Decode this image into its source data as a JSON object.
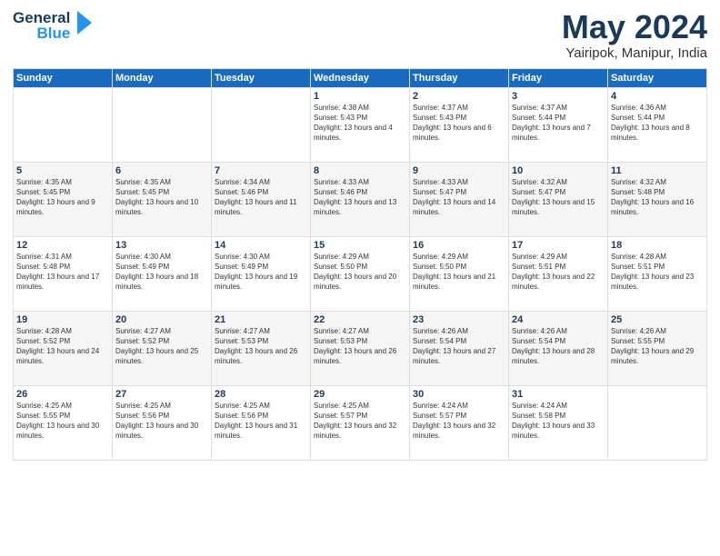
{
  "header": {
    "logo_line1": "General",
    "logo_line2": "Blue",
    "month": "May 2024",
    "location": "Yairipok, Manipur, India"
  },
  "days_of_week": [
    "Sunday",
    "Monday",
    "Tuesday",
    "Wednesday",
    "Thursday",
    "Friday",
    "Saturday"
  ],
  "weeks": [
    [
      {
        "day": "",
        "sunrise": "",
        "sunset": "",
        "daylight": ""
      },
      {
        "day": "",
        "sunrise": "",
        "sunset": "",
        "daylight": ""
      },
      {
        "day": "",
        "sunrise": "",
        "sunset": "",
        "daylight": ""
      },
      {
        "day": "1",
        "sunrise": "Sunrise: 4:38 AM",
        "sunset": "Sunset: 5:43 PM",
        "daylight": "Daylight: 13 hours and 4 minutes."
      },
      {
        "day": "2",
        "sunrise": "Sunrise: 4:37 AM",
        "sunset": "Sunset: 5:43 PM",
        "daylight": "Daylight: 13 hours and 6 minutes."
      },
      {
        "day": "3",
        "sunrise": "Sunrise: 4:37 AM",
        "sunset": "Sunset: 5:44 PM",
        "daylight": "Daylight: 13 hours and 7 minutes."
      },
      {
        "day": "4",
        "sunrise": "Sunrise: 4:36 AM",
        "sunset": "Sunset: 5:44 PM",
        "daylight": "Daylight: 13 hours and 8 minutes."
      }
    ],
    [
      {
        "day": "5",
        "sunrise": "Sunrise: 4:35 AM",
        "sunset": "Sunset: 5:45 PM",
        "daylight": "Daylight: 13 hours and 9 minutes."
      },
      {
        "day": "6",
        "sunrise": "Sunrise: 4:35 AM",
        "sunset": "Sunset: 5:45 PM",
        "daylight": "Daylight: 13 hours and 10 minutes."
      },
      {
        "day": "7",
        "sunrise": "Sunrise: 4:34 AM",
        "sunset": "Sunset: 5:46 PM",
        "daylight": "Daylight: 13 hours and 11 minutes."
      },
      {
        "day": "8",
        "sunrise": "Sunrise: 4:33 AM",
        "sunset": "Sunset: 5:46 PM",
        "daylight": "Daylight: 13 hours and 13 minutes."
      },
      {
        "day": "9",
        "sunrise": "Sunrise: 4:33 AM",
        "sunset": "Sunset: 5:47 PM",
        "daylight": "Daylight: 13 hours and 14 minutes."
      },
      {
        "day": "10",
        "sunrise": "Sunrise: 4:32 AM",
        "sunset": "Sunset: 5:47 PM",
        "daylight": "Daylight: 13 hours and 15 minutes."
      },
      {
        "day": "11",
        "sunrise": "Sunrise: 4:32 AM",
        "sunset": "Sunset: 5:48 PM",
        "daylight": "Daylight: 13 hours and 16 minutes."
      }
    ],
    [
      {
        "day": "12",
        "sunrise": "Sunrise: 4:31 AM",
        "sunset": "Sunset: 5:48 PM",
        "daylight": "Daylight: 13 hours and 17 minutes."
      },
      {
        "day": "13",
        "sunrise": "Sunrise: 4:30 AM",
        "sunset": "Sunset: 5:49 PM",
        "daylight": "Daylight: 13 hours and 18 minutes."
      },
      {
        "day": "14",
        "sunrise": "Sunrise: 4:30 AM",
        "sunset": "Sunset: 5:49 PM",
        "daylight": "Daylight: 13 hours and 19 minutes."
      },
      {
        "day": "15",
        "sunrise": "Sunrise: 4:29 AM",
        "sunset": "Sunset: 5:50 PM",
        "daylight": "Daylight: 13 hours and 20 minutes."
      },
      {
        "day": "16",
        "sunrise": "Sunrise: 4:29 AM",
        "sunset": "Sunset: 5:50 PM",
        "daylight": "Daylight: 13 hours and 21 minutes."
      },
      {
        "day": "17",
        "sunrise": "Sunrise: 4:29 AM",
        "sunset": "Sunset: 5:51 PM",
        "daylight": "Daylight: 13 hours and 22 minutes."
      },
      {
        "day": "18",
        "sunrise": "Sunrise: 4:28 AM",
        "sunset": "Sunset: 5:51 PM",
        "daylight": "Daylight: 13 hours and 23 minutes."
      }
    ],
    [
      {
        "day": "19",
        "sunrise": "Sunrise: 4:28 AM",
        "sunset": "Sunset: 5:52 PM",
        "daylight": "Daylight: 13 hours and 24 minutes."
      },
      {
        "day": "20",
        "sunrise": "Sunrise: 4:27 AM",
        "sunset": "Sunset: 5:52 PM",
        "daylight": "Daylight: 13 hours and 25 minutes."
      },
      {
        "day": "21",
        "sunrise": "Sunrise: 4:27 AM",
        "sunset": "Sunset: 5:53 PM",
        "daylight": "Daylight: 13 hours and 26 minutes."
      },
      {
        "day": "22",
        "sunrise": "Sunrise: 4:27 AM",
        "sunset": "Sunset: 5:53 PM",
        "daylight": "Daylight: 13 hours and 26 minutes."
      },
      {
        "day": "23",
        "sunrise": "Sunrise: 4:26 AM",
        "sunset": "Sunset: 5:54 PM",
        "daylight": "Daylight: 13 hours and 27 minutes."
      },
      {
        "day": "24",
        "sunrise": "Sunrise: 4:26 AM",
        "sunset": "Sunset: 5:54 PM",
        "daylight": "Daylight: 13 hours and 28 minutes."
      },
      {
        "day": "25",
        "sunrise": "Sunrise: 4:26 AM",
        "sunset": "Sunset: 5:55 PM",
        "daylight": "Daylight: 13 hours and 29 minutes."
      }
    ],
    [
      {
        "day": "26",
        "sunrise": "Sunrise: 4:25 AM",
        "sunset": "Sunset: 5:55 PM",
        "daylight": "Daylight: 13 hours and 30 minutes."
      },
      {
        "day": "27",
        "sunrise": "Sunrise: 4:25 AM",
        "sunset": "Sunset: 5:56 PM",
        "daylight": "Daylight: 13 hours and 30 minutes."
      },
      {
        "day": "28",
        "sunrise": "Sunrise: 4:25 AM",
        "sunset": "Sunset: 5:56 PM",
        "daylight": "Daylight: 13 hours and 31 minutes."
      },
      {
        "day": "29",
        "sunrise": "Sunrise: 4:25 AM",
        "sunset": "Sunset: 5:57 PM",
        "daylight": "Daylight: 13 hours and 32 minutes."
      },
      {
        "day": "30",
        "sunrise": "Sunrise: 4:24 AM",
        "sunset": "Sunset: 5:57 PM",
        "daylight": "Daylight: 13 hours and 32 minutes."
      },
      {
        "day": "31",
        "sunrise": "Sunrise: 4:24 AM",
        "sunset": "Sunset: 5:58 PM",
        "daylight": "Daylight: 13 hours and 33 minutes."
      },
      {
        "day": "",
        "sunrise": "",
        "sunset": "",
        "daylight": ""
      }
    ]
  ]
}
